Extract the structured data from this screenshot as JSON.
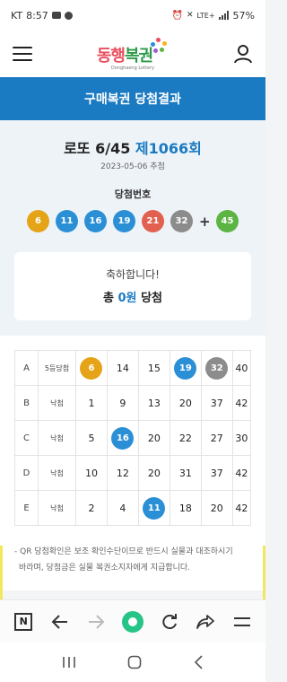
{
  "status_bar": {
    "carrier": "KT",
    "time": "8:57",
    "network": "LTE+",
    "battery": "57%"
  },
  "header": {
    "logo_text_a": "동행",
    "logo_text_b": "복권",
    "logo_sub": "Donghaeng Lottery"
  },
  "page": {
    "title": "구매복권 당첨결과"
  },
  "draw": {
    "name": "로또 6/45",
    "round": "제1066회",
    "date": "2023-05-06 추첨",
    "win_label": "당첨번호",
    "numbers": [
      {
        "value": "6",
        "color": "#e5a417"
      },
      {
        "value": "11",
        "color": "#2b8fd6"
      },
      {
        "value": "16",
        "color": "#2b8fd6"
      },
      {
        "value": "19",
        "color": "#2b8fd6"
      },
      {
        "value": "21",
        "color": "#e2604f"
      },
      {
        "value": "32",
        "color": "#8c8c8c"
      }
    ],
    "plus": "+",
    "bonus": {
      "value": "45",
      "color": "#5cb443"
    }
  },
  "result": {
    "congrats": "축하합니다!",
    "prize_prefix": "총",
    "prize_amount": "0원",
    "prize_suffix": "당첨"
  },
  "ticket": {
    "rows": [
      {
        "game": "A",
        "result": "5등당첨",
        "numbers": [
          {
            "v": "6",
            "hit": "#e5a417"
          },
          {
            "v": "14"
          },
          {
            "v": "15"
          },
          {
            "v": "19",
            "hit": "#2b8fd6"
          },
          {
            "v": "32",
            "hit": "#8c8c8c"
          },
          {
            "v": "40"
          }
        ]
      },
      {
        "game": "B",
        "result": "낙첨",
        "numbers": [
          {
            "v": "1"
          },
          {
            "v": "9"
          },
          {
            "v": "13"
          },
          {
            "v": "20"
          },
          {
            "v": "37"
          },
          {
            "v": "42"
          }
        ]
      },
      {
        "game": "C",
        "result": "낙첨",
        "numbers": [
          {
            "v": "5"
          },
          {
            "v": "16",
            "hit": "#2b8fd6"
          },
          {
            "v": "20"
          },
          {
            "v": "22"
          },
          {
            "v": "27"
          },
          {
            "v": "30"
          }
        ]
      },
      {
        "game": "D",
        "result": "낙첨",
        "numbers": [
          {
            "v": "10"
          },
          {
            "v": "12"
          },
          {
            "v": "20"
          },
          {
            "v": "31"
          },
          {
            "v": "37"
          },
          {
            "v": "42"
          }
        ]
      },
      {
        "game": "E",
        "result": "낙첨",
        "numbers": [
          {
            "v": "2"
          },
          {
            "v": "4"
          },
          {
            "v": "11",
            "hit": "#2b8fd6"
          },
          {
            "v": "18"
          },
          {
            "v": "20"
          },
          {
            "v": "42"
          }
        ]
      }
    ]
  },
  "notice": {
    "line1": "- QR 당첨확인은 보조 확인수단이므로 반드시 실물과 대조하시기",
    "line2": "바라며, 당첨금은 실물 복권소지자에게 지급합니다."
  },
  "browser_bar": {
    "tab_icon_label": "N"
  }
}
